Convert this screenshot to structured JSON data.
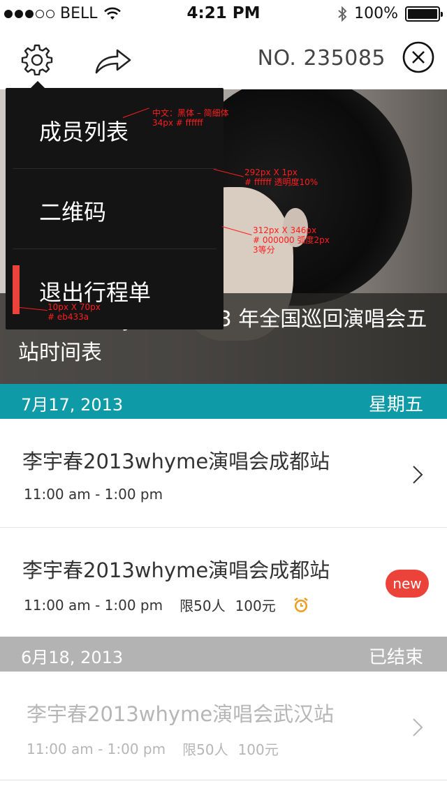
{
  "status_bar": {
    "carrier": "BELL",
    "time": "4:21 PM",
    "battery": "100%",
    "battery_level": 1.0
  },
  "nav": {
    "number": "NO. 235085"
  },
  "hero": {
    "title": "李宇春 Why Me 2013 年全国巡回演唱会五站时间表"
  },
  "menu": {
    "items": [
      {
        "label": "成员列表"
      },
      {
        "label": "二维码"
      },
      {
        "label": "退出行程单"
      }
    ]
  },
  "annotations": {
    "font": "中文：黑体 – 简细体",
    "font_size": "34px    # ffffff",
    "divider_size": "292px X 1px",
    "divider_color": "# ffffff  透明度10%",
    "menu_size": "312px X 346px",
    "menu_color": "# 000000  弧度2px",
    "menu_split": "3等分",
    "bar_size": "10px X 70px",
    "bar_color": "# eb433a"
  },
  "sections": [
    {
      "date": "7月17, 2013",
      "day": "星期五",
      "events": [
        {
          "name": "李宇春2013whyme演唱会成都站",
          "time": "11:00 am - 1:00 pm"
        },
        {
          "name": "李宇春2013whyme演唱会成都站",
          "time": "11:00 am - 1:00 pm",
          "limit": "限50人",
          "price": "100元",
          "badge": "new"
        }
      ]
    },
    {
      "date": "6月18, 2013",
      "day": "已结束",
      "events": [
        {
          "name": "李宇春2013whyme演唱会武汉站",
          "time": "11:00 am - 1:00 pm",
          "limit": "限50人",
          "price": "100元"
        }
      ]
    }
  ],
  "colors": {
    "teal": "#0f9aa7",
    "red": "#eb433a",
    "grey": "#b3b3b3"
  }
}
